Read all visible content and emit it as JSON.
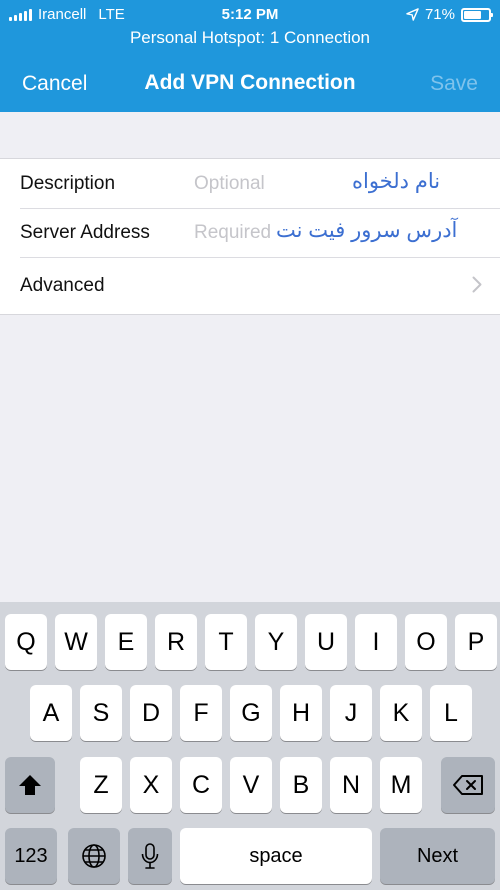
{
  "status_bar": {
    "carrier": "Irancell",
    "network": "LTE",
    "time": "5:12 PM",
    "battery": "71%",
    "battery_level": 0.71
  },
  "hotspot_banner": "Personal Hotspot: 1 Connection",
  "nav": {
    "cancel": "Cancel",
    "title": "Add VPN Connection",
    "save": "Save"
  },
  "form": {
    "description": {
      "label": "Description",
      "placeholder": "Optional",
      "annotation": "نام دلخواه"
    },
    "server": {
      "label": "Server Address",
      "placeholder": "Required",
      "annotation": "آدرس سرور فیت نت"
    },
    "advanced": {
      "label": "Advanced"
    }
  },
  "keyboard": {
    "row1": [
      "Q",
      "W",
      "E",
      "R",
      "T",
      "Y",
      "U",
      "I",
      "O",
      "P"
    ],
    "row2": [
      "A",
      "S",
      "D",
      "F",
      "G",
      "H",
      "J",
      "K",
      "L"
    ],
    "row3": [
      "Z",
      "X",
      "C",
      "V",
      "B",
      "N",
      "M"
    ],
    "numbers": "123",
    "space": "space",
    "next": "Next"
  },
  "colors": {
    "accent": "#1f97dc",
    "save_disabled": "#7fc3ec",
    "annotation": "#3c6fd1",
    "keyboard_bg": "#d2d5db",
    "function_key": "#adb3bc"
  }
}
